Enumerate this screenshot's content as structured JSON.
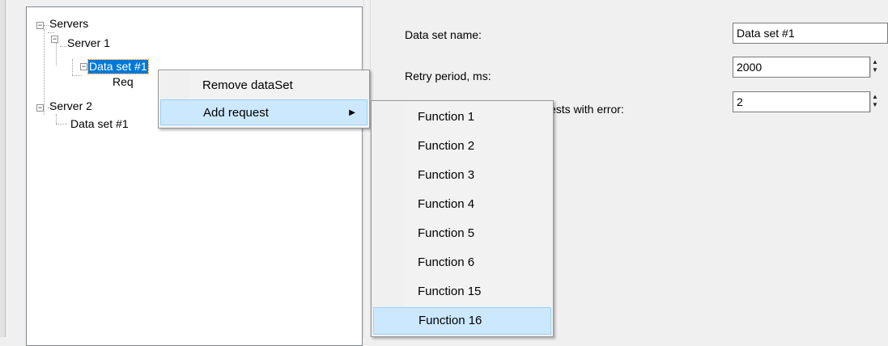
{
  "tree": {
    "root": "Servers",
    "server1": "Server 1",
    "dataset1": "Data set #1",
    "request": "Req",
    "server2": "Server 2",
    "dataset2": "Data set #1"
  },
  "form": {
    "name_label": "Data set name:",
    "name_value": "Data set #1",
    "retry_label": "Retry period, ms:",
    "retry_value": "2000",
    "errors_label_visible": "ests with error:",
    "errors_value": "2"
  },
  "context_menu": {
    "items": [
      "Remove dataSet",
      "Add request"
    ],
    "highlighted": "Add request"
  },
  "submenu": {
    "items": [
      "Function 1",
      "Function 2",
      "Function 3",
      "Function 4",
      "Function 5",
      "Function 6",
      "Function 15",
      "Function 16"
    ],
    "highlighted": "Function 16"
  },
  "icons": {
    "expand": "minus-box-icon",
    "submenu": "submenu-arrow-icon",
    "spin": "spin-updown-icon"
  }
}
